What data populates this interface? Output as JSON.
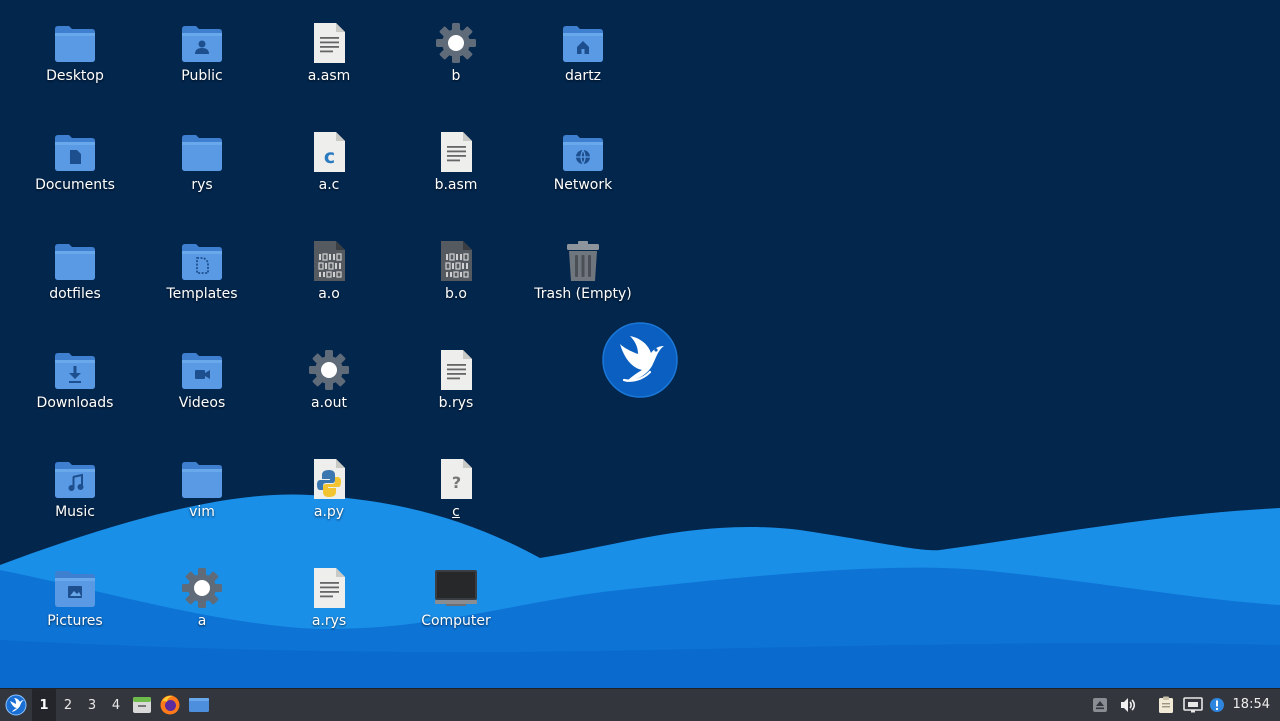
{
  "desktop": {
    "icons": [
      {
        "label": "Desktop",
        "type": "folder-plain"
      },
      {
        "label": "Documents",
        "type": "folder-documents"
      },
      {
        "label": "dotfiles",
        "type": "folder-plain"
      },
      {
        "label": "Downloads",
        "type": "folder-download"
      },
      {
        "label": "Music",
        "type": "folder-music"
      },
      {
        "label": "Pictures",
        "type": "folder-pictures"
      },
      {
        "label": "Public",
        "type": "folder-public"
      },
      {
        "label": "rys",
        "type": "folder-plain"
      },
      {
        "label": "Templates",
        "type": "folder-templates"
      },
      {
        "label": "Videos",
        "type": "folder-videos"
      },
      {
        "label": "vim",
        "type": "folder-plain"
      },
      {
        "label": "a",
        "type": "executable-gear"
      },
      {
        "label": "a.asm",
        "type": "text-file"
      },
      {
        "label": "a.c",
        "type": "c-source-file"
      },
      {
        "label": "a.o",
        "type": "binary-file"
      },
      {
        "label": "a.out",
        "type": "executable-gear"
      },
      {
        "label": "a.py",
        "type": "python-file"
      },
      {
        "label": "a.rys",
        "type": "text-file"
      },
      {
        "label": "b",
        "type": "executable-gear"
      },
      {
        "label": "b.asm",
        "type": "text-file"
      },
      {
        "label": "b.o",
        "type": "binary-file"
      },
      {
        "label": "b.rys",
        "type": "text-file"
      },
      {
        "label": "c",
        "type": "unknown-file"
      },
      {
        "label": "Computer",
        "type": "computer"
      },
      {
        "label": "dartz",
        "type": "folder-home"
      },
      {
        "label": "Network",
        "type": "folder-network"
      },
      {
        "label": "Trash (Empty)",
        "type": "trash-empty"
      }
    ]
  },
  "taskbar": {
    "start_icon": "linux-lite-menu-icon",
    "workspaces": [
      {
        "label": "1",
        "active": true
      },
      {
        "label": "2",
        "active": false
      },
      {
        "label": "3",
        "active": false
      },
      {
        "label": "4",
        "active": false
      }
    ],
    "launchers": [
      "file-manager-icon",
      "firefox-icon",
      "show-desktop-icon"
    ],
    "tray": [
      "eject-icon",
      "volume-icon",
      "clipboard-icon",
      "network-icon",
      "update-notifier-icon"
    ],
    "clock": "18:54"
  },
  "colors": {
    "sky": "#03264d",
    "wave_light": "#0a8ee8",
    "wave_dark": "#0a64c8",
    "folder": "#4d8fdc",
    "taskbar": "#33363c"
  }
}
